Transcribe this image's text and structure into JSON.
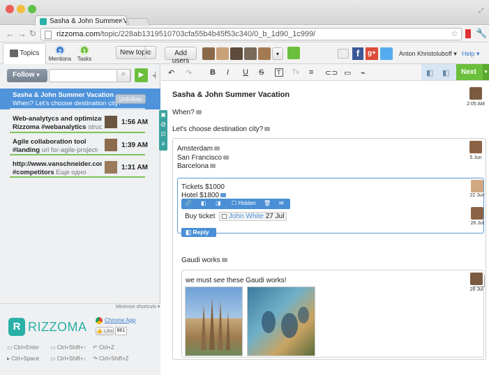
{
  "browser": {
    "tab_title": "Sasha & John Summer Vacati",
    "url_host": "rizzoma.com",
    "url_path": "/topic/228ab1319510703cfa55b4b45f53c340/0_b_1d90_1c999/"
  },
  "header": {
    "tabs": [
      {
        "label": "Topics",
        "badge": ""
      },
      {
        "label": "Mentions",
        "badge": "2"
      },
      {
        "label": "Tasks",
        "badge": "1"
      }
    ],
    "new_topic_label": "New topic",
    "add_users_label": "Add users",
    "user_name": "Anton Khristoluboff",
    "help_label": "Help",
    "next_label": "Next"
  },
  "sidebar": {
    "follow_label": "Follow",
    "topics": [
      {
        "title": "Sasha & John Summer Vacation",
        "subtitle": "When? Let's choose destination city?",
        "action": "Unfollow",
        "time": ""
      },
      {
        "title": "Web-analytycs and optimization",
        "subtitle": "Rizzoma #webanalytics",
        "subtitle_muted": "structure",
        "time": "1:56 AM"
      },
      {
        "title": "Agile collaboration tool",
        "subtitle": "#landing",
        "subtitle_muted": "url for-agile-project-",
        "time": "1:39 AM"
      },
      {
        "title": "http://www.vanschneider.com/wc",
        "subtitle": "#competitors",
        "subtitle_muted": "Еще одно",
        "time": "1:31 AM"
      }
    ],
    "minimize_label": "Minimize shortcuts",
    "logo_text": "RIZZOMA",
    "chrome_app_label": "Chrome App",
    "like_label": "Like",
    "like_count": "861",
    "shortcuts": [
      {
        "keys": "Ctrl+Enter"
      },
      {
        "keys": "Ctrl+Shift+↑"
      },
      {
        "keys": "Ctrl+Z"
      },
      {
        "keys": "Ctrl+Space"
      },
      {
        "keys": "Ctrl+Shift+↓"
      },
      {
        "keys": "Ctrl+Shift+Z"
      }
    ]
  },
  "topic": {
    "title": "Sasha & John Summer Vacation",
    "title_date": "2:05 AM",
    "line_when": "When?",
    "line_choose": "Let's choose destination city?",
    "cities": [
      "Amsterdam",
      "San Francisco",
      "Barcelona"
    ],
    "cities_date": "5 Jun",
    "tickets": "Tickets $1000",
    "hotel": "Hotel $1800",
    "tickets_date": "22 Jun",
    "blip_toolbar_hidden": "Hidden",
    "buy_ticket": "Buy ticket",
    "assignee": "John White",
    "task_date": "27 Jul",
    "buy_date": "26 Jul",
    "reply_label": "Reply",
    "gaudi": "Gaudi works",
    "gaudi_reply": "we must see these Gaudi works!",
    "gaudi_date": "26 Jul"
  },
  "colors": {
    "accent_blue": "#4a8fd6",
    "green": "#7dc45a",
    "next_green": "#6cbf3c"
  }
}
